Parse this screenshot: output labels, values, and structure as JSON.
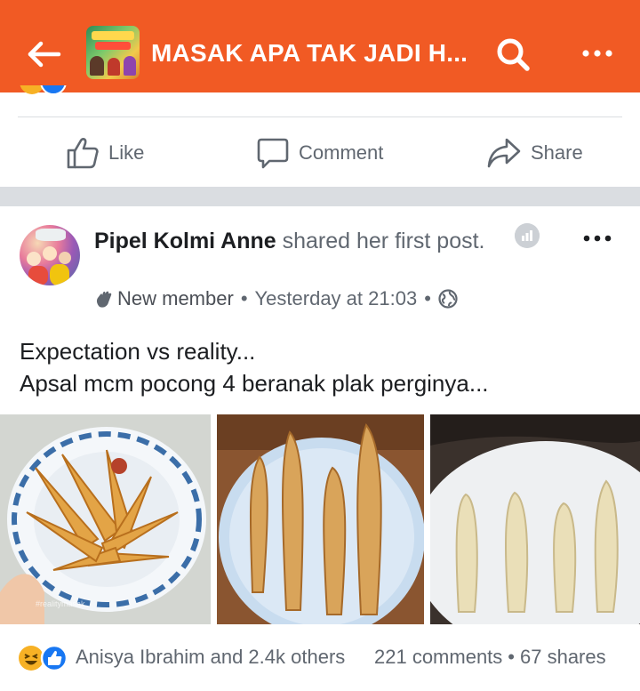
{
  "header": {
    "title": "MASAK APA TAK JADI H...",
    "thumb_text": "MASAK APA TAK JADI HARI INI",
    "bg_color": "#f15a24"
  },
  "actions": {
    "like": "Like",
    "comment": "Comment",
    "share": "Share"
  },
  "post": {
    "author": "Pipel Kolmi Anne",
    "action_text": " shared her first post.",
    "badge": "New member",
    "time": "Yesterday at 21:03",
    "privacy_icon": "globe-icon",
    "text_line1": "Expectation vs reality...",
    "text_line2": "Apsal mcm pocong 4 beranak plak perginya...",
    "photo_watermark": "#realitymasak"
  },
  "footer": {
    "reactors": "Anisya Ibrahim and 2.4k others",
    "comments": "221 comments",
    "separator": "•",
    "shares": "67 shares"
  },
  "colors": {
    "accent": "#f15a24",
    "like_blue": "#1877f2",
    "haha_yellow": "#f7b125",
    "secondary_text": "#606770"
  }
}
